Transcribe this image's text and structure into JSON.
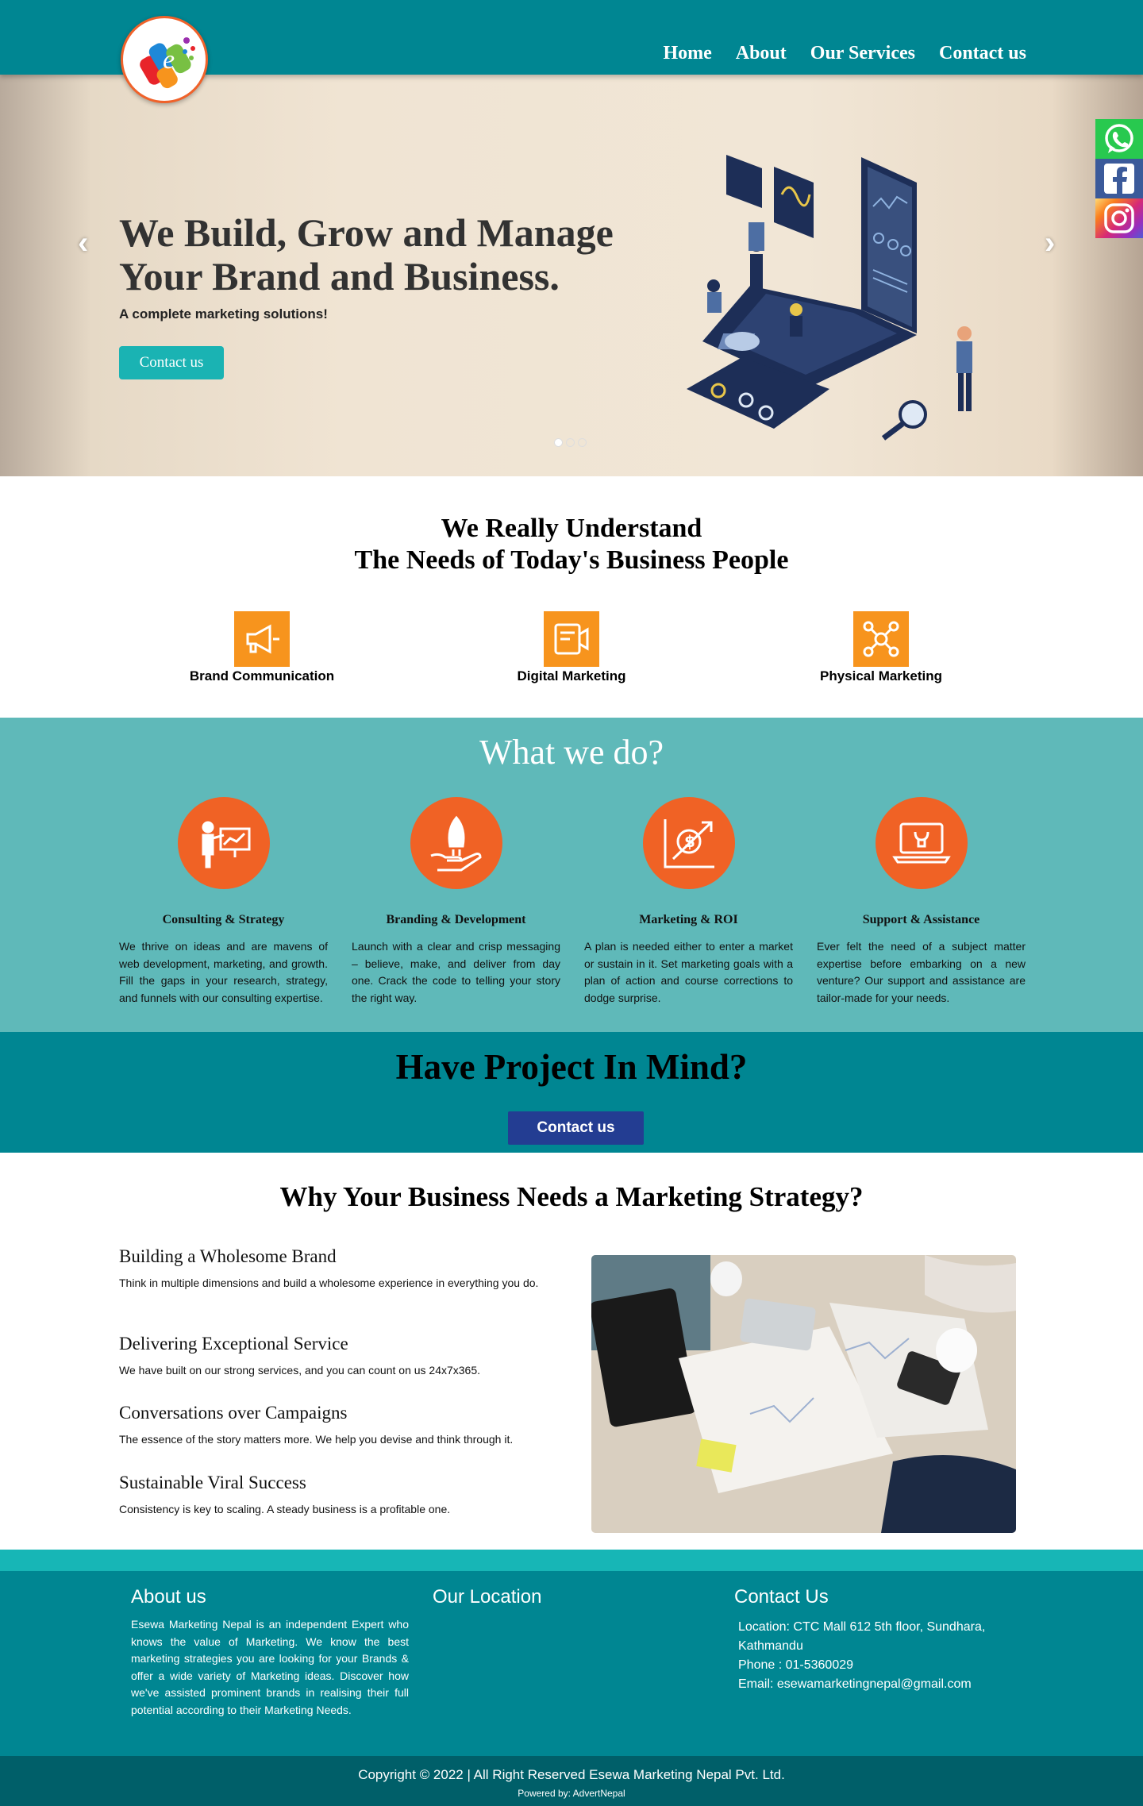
{
  "nav": {
    "home": "Home",
    "about": "About",
    "services": "Our Services",
    "contact": "Contact us"
  },
  "hero": {
    "title_line1": "We Build, Grow and Manage",
    "title_line2": "Your Brand and Business.",
    "subtitle": "A complete marketing solutions!",
    "cta": "Contact us",
    "slide_index": 1,
    "slide_count": 3
  },
  "understand": {
    "line1": "We Really Understand",
    "line2": "The Needs of Today's Business People",
    "features": [
      {
        "label": "Brand Communication",
        "icon": "megaphone-icon"
      },
      {
        "label": "Digital Marketing",
        "icon": "digital-marketing-icon"
      },
      {
        "label": "Physical Marketing",
        "icon": "network-people-icon"
      }
    ]
  },
  "whatwedo": {
    "title": "What we do?",
    "services": [
      {
        "title": "Consulting & Strategy",
        "text": "We thrive on ideas and are mavens of web development, marketing, and growth. Fill the gaps in your research, strategy, and funnels with our consulting expertise.",
        "icon": "presentation-icon"
      },
      {
        "title": "Branding & Development",
        "text": "Launch with a clear and crisp messaging – believe, make, and deliver from day one. Crack the code to telling your story the right way.",
        "icon": "rocket-hand-icon"
      },
      {
        "title": "Marketing & ROI",
        "text": "A plan is needed either to enter a market or sustain in it. Set marketing goals with a plan of action and course corrections to dodge surprise.",
        "icon": "roi-chart-icon"
      },
      {
        "title": "Support & Assistance",
        "text": "Ever felt the need of a subject matter expertise before embarking on a new venture? Our support and assistance are tailor-made for your needs.",
        "icon": "laptop-wrench-icon"
      }
    ]
  },
  "project": {
    "title": "Have Project In Mind?",
    "button": "Contact us"
  },
  "strategy": {
    "title": "Why Your Business Needs a Marketing Strategy?",
    "items": [
      {
        "heading": "Building a Wholesome Brand",
        "text": "Think in multiple dimensions and build a wholesome experience in everything you do."
      },
      {
        "heading": "Delivering Exceptional Service",
        "text": "We have built on our strong services, and you can count on us 24x7x365."
      },
      {
        "heading": "Conversations over Campaigns",
        "text": "The essence of the story matters more. We help you devise and think through it."
      },
      {
        "heading": "Sustainable Viral Success",
        "text": "Consistency is key to scaling. A steady business is a profitable one."
      }
    ]
  },
  "footer": {
    "about_title": "About us",
    "about_text": "Esewa Marketing Nepal is an independent Expert who knows the value of Marketing. We know the best marketing strategies you are looking for your Brands & offer a wide variety of Marketing ideas. Discover how we've assisted prominent brands in realising their full potential according to their Marketing Needs.",
    "location_title": "Our Location",
    "contact_title": "Contact Us",
    "location": "Location: CTC Mall 612 5th floor, Sundhara, Kathmandu",
    "phone": "Phone : 01-5360029",
    "email": "Email: esewamarketingnepal@gmail.com",
    "copyright": "Copyright © 2022 | All Right Reserved Esewa Marketing Nepal Pvt. Ltd.",
    "powered": "Powered by: AdvertNepal"
  },
  "colors": {
    "header": "#008692",
    "accent": "#1ab3b3",
    "orange": "#f06225",
    "feature_orange": "#f7941d",
    "button_blue": "#233d92",
    "section_teal": "#5fb9b9"
  }
}
